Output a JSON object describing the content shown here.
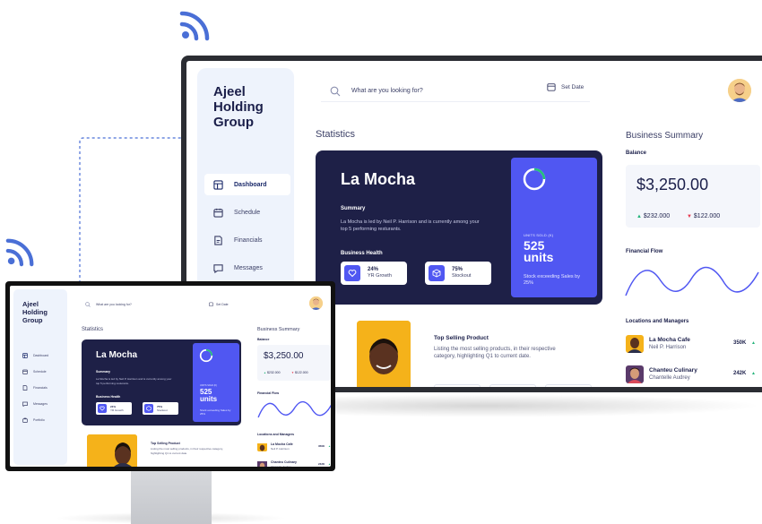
{
  "colors": {
    "accent": "#5057f2",
    "card_dark": "#1e2047",
    "sidebar_bg": "#eef3fc",
    "product_bg": "#f5b21a",
    "positive": "#23b37a",
    "negative": "#e6394f",
    "connector": "#4a6fd6"
  },
  "icons": {
    "wifi": "wifi-icon",
    "search": "search-icon",
    "calendar": "calendar-icon",
    "dashboard": "dashboard-icon",
    "schedule": "schedule-icon",
    "financials": "document-icon",
    "messages": "chat-icon",
    "heart": "heart-icon",
    "box": "box-icon"
  },
  "app": {
    "logo": "Ajeel\nHolding\nGroup"
  },
  "header": {
    "search_placeholder": "What are you looking for?",
    "date_label": "Set Date"
  },
  "sidebar": {
    "items": [
      {
        "label": "Dashboard",
        "active": true
      },
      {
        "label": "Schedule",
        "active": false
      },
      {
        "label": "Financials",
        "active": false
      },
      {
        "label": "Messages",
        "active": false
      },
      {
        "label": "Portfolio",
        "active": false
      }
    ]
  },
  "statistics": {
    "title": "Statistics",
    "card": {
      "name": "La Mocha",
      "summary_label": "Summary",
      "summary_text": "La Mocha is led by Neil P. Harrison and is currently among your top 5 performing resturants.",
      "health_label": "Business Health",
      "metrics": [
        {
          "value": "24%",
          "label": "YR Growth"
        },
        {
          "value": "75%",
          "label": "Stockout"
        }
      ],
      "units": {
        "label": "UNITS SOLD (K)",
        "value": "525",
        "unit": "units",
        "note": "Stock exceeding Sales by 25%"
      }
    }
  },
  "top_selling": {
    "title": "Top Selling Product",
    "description": "Listing the most selling products, in their respective category, highlighting Q1 to current date."
  },
  "business_summary": {
    "title": "Business Summary",
    "balance_label": "Balance",
    "balance_value": "$3,250.00",
    "up_value": "$232.000",
    "down_value": "$122.000",
    "flow_label": "Financial Flow",
    "locations_label": "Locations and Managers",
    "locations": [
      {
        "name": "La Mocha Cafe",
        "manager": "Neil P. Harrison",
        "amount": "350K"
      },
      {
        "name": "Chanteu Culinary",
        "manager": "Chantelle Audrey",
        "amount": "242K"
      }
    ]
  }
}
